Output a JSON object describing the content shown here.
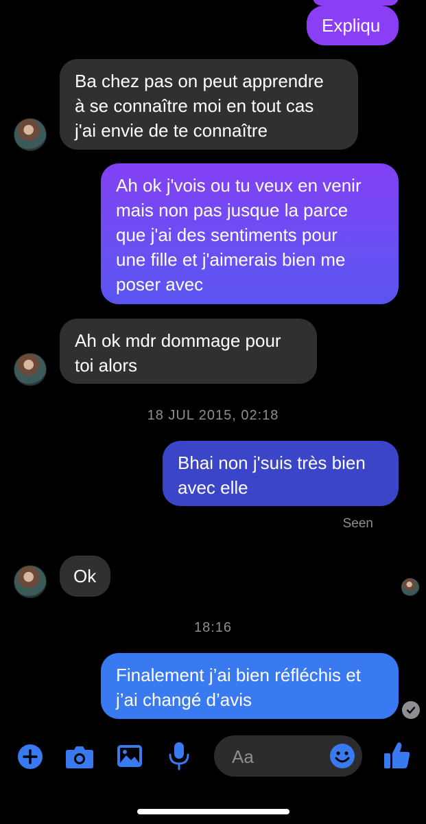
{
  "messages": [
    {
      "id": 1,
      "dir": "out",
      "text": "Expliqu"
    },
    {
      "id": 2,
      "dir": "in",
      "lines": [
        "Ba chez pas on peut apprendre",
        "à se connaître moi en tout cas",
        "j'ai envie de te connaître"
      ]
    },
    {
      "id": 3,
      "dir": "out",
      "lines": [
        "Ah ok j'vois ou tu veux en venir",
        "mais non pas jusque la parce",
        "que j'ai des sentiments pour",
        "une fille et j'aimerais bien me",
        "poser avec"
      ]
    },
    {
      "id": 4,
      "dir": "in",
      "lines": [
        "Ah ok mdr dommage pour",
        "toi alors"
      ]
    },
    {
      "id": 5,
      "dir": "out",
      "lines": [
        "Bhai non j'suis très bien",
        "avec elle"
      ]
    },
    {
      "id": 6,
      "dir": "in",
      "text": "Ok"
    },
    {
      "id": 7,
      "dir": "out",
      "lines": [
        "Finalement j’ai bien réfléchis et",
        "j’ai changé d’avis"
      ]
    }
  ],
  "timestamps": {
    "first": "18 JUL 2015, 02:18",
    "second": "18:16"
  },
  "read_receipt": "Seen",
  "composer": {
    "placeholder": "Aa"
  },
  "icons": [
    "plus-icon",
    "camera-icon",
    "image-icon",
    "microphone-icon",
    "emoji-icon",
    "thumbs-up-icon",
    "delivered-check-icon"
  ],
  "colors": {
    "accent": "#3a7af0",
    "incoming_bubble": "#303030",
    "gradient_top": "#8a3ff5",
    "gradient_bottom": "#3b63f0"
  }
}
